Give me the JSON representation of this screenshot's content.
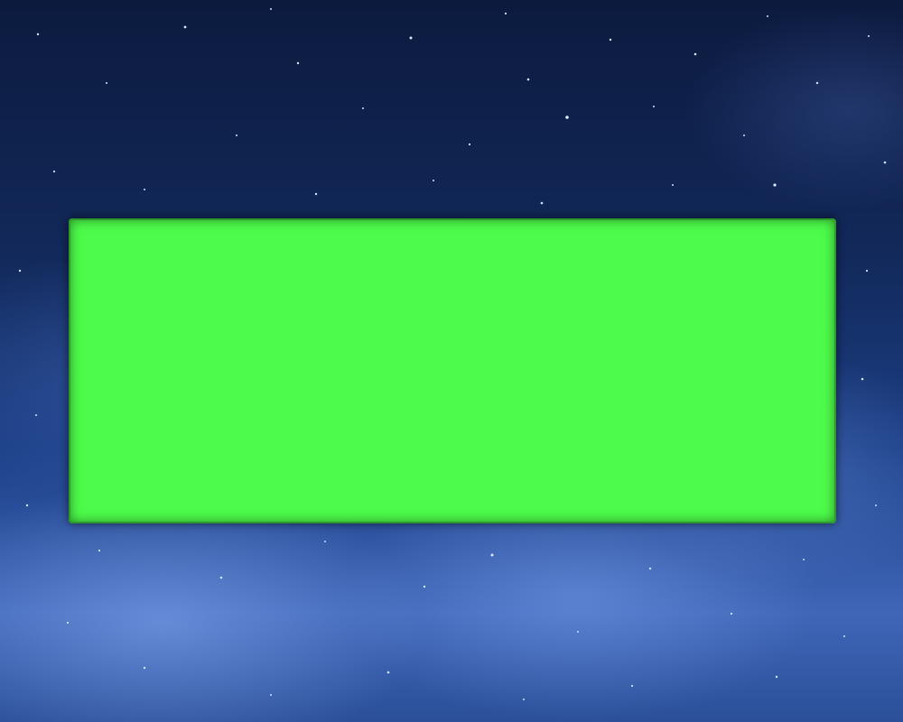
{
  "scene": {
    "background": "starry-nebula-space",
    "panel_color": "#4dfb4a",
    "colors": {
      "space_dark": "#0c1a3e",
      "space_mid": "#1c3f86",
      "nebula_light": "#3f66b8",
      "star": "#cfe6ff"
    }
  }
}
